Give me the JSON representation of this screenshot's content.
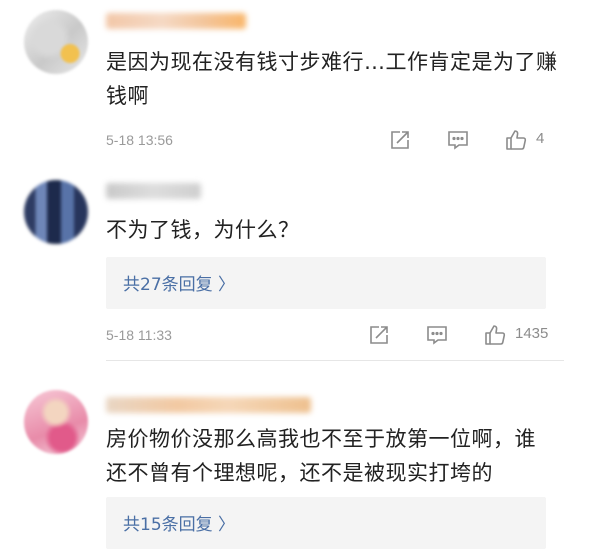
{
  "comments": [
    {
      "text": "是因为现在没有钱寸步难行…工作肯定是为了赚钱啊",
      "time": "5-18 13:56",
      "likes": "4"
    },
    {
      "text": "不为了钱，为什么？",
      "replies_label": "共27条回复 〉",
      "time": "5-18 11:33",
      "likes": "1435"
    },
    {
      "text": "房价物价没那么高我也不至于放第一位啊，谁还不曾有个理想呢，还不是被现实打垮的",
      "replies_label": "共15条回复 〉"
    }
  ],
  "icons": {
    "share": "share-icon",
    "comment": "comment-icon",
    "like": "thumbs-up-icon"
  },
  "colors": {
    "link": "#4a6fa5",
    "meta": "#9a9a9a",
    "reply_bg": "#f4f4f4"
  }
}
